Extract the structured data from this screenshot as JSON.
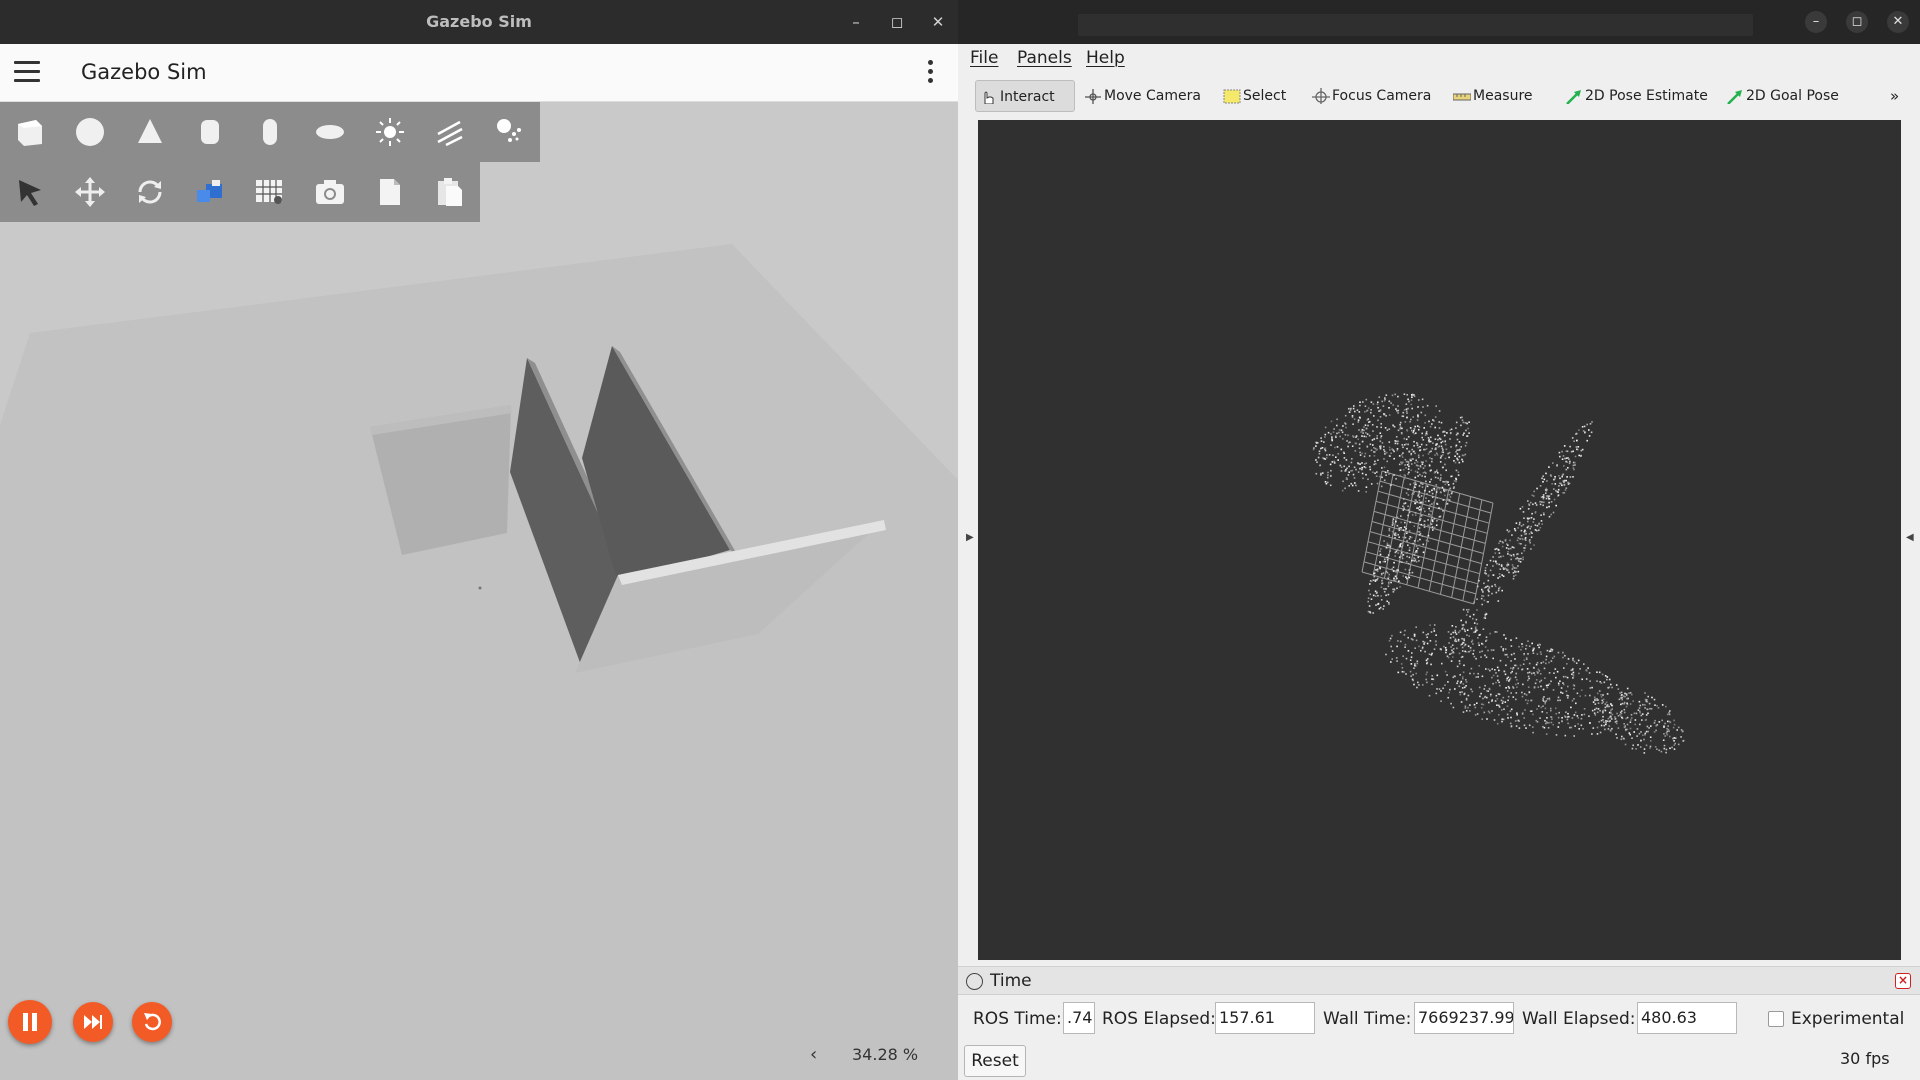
{
  "gazebo": {
    "window_title": "Gazebo Sim",
    "app_title": "Gazebo Sim",
    "window_controls": [
      "–",
      "◻",
      "✕"
    ],
    "shape_tools": [
      "box-icon",
      "sphere-icon",
      "cone-icon",
      "cylinder-icon",
      "capsule-icon",
      "ellipsoid-icon",
      "point-light-icon",
      "directional-light-icon",
      "spot-light-icon"
    ],
    "transform_tools": [
      "select-arrow-icon",
      "translate-icon",
      "rotate-icon",
      "scale-icon",
      "grid-snap-icon",
      "camera-icon",
      "copy-icon",
      "paste-icon"
    ],
    "real_time_factor": "34.28 %",
    "collapse_arrow": "‹"
  },
  "rviz": {
    "window_controls": [
      "–",
      "◻",
      "✕"
    ],
    "menu": [
      "File",
      "Panels",
      "Help"
    ],
    "toolbar": [
      {
        "label": "Interact",
        "icon": "hand-pointer-icon",
        "active": true
      },
      {
        "label": "Move Camera",
        "icon": "move-camera-icon",
        "active": false
      },
      {
        "label": "Select",
        "icon": "select-rect-icon",
        "active": false
      },
      {
        "label": "Focus Camera",
        "icon": "focus-crosshair-icon",
        "active": false
      },
      {
        "label": "Measure",
        "icon": "ruler-icon",
        "active": false
      },
      {
        "label": "2D Pose Estimate",
        "icon": "green-arrow-icon",
        "active": false
      },
      {
        "label": "2D Goal Pose",
        "icon": "green-arrow-icon",
        "active": false
      }
    ],
    "toolbar_overflow": "»",
    "time_panel": {
      "title": "Time",
      "ros_time_label": "ROS Time:",
      "ros_time_value": ".74",
      "ros_elapsed_label": "ROS Elapsed:",
      "ros_elapsed_value": "157.61",
      "wall_time_label": "Wall Time:",
      "wall_time_value": "7669237.99",
      "wall_elapsed_label": "Wall Elapsed:",
      "wall_elapsed_value": "480.63",
      "experimental_label": "Experimental",
      "experimental_checked": false,
      "reset_label": "Reset",
      "fps": "30 fps"
    }
  },
  "colors": {
    "gazebo_accent": "#f35b26",
    "rviz_background": "#303030",
    "pose_arrow": "#22b14c"
  }
}
